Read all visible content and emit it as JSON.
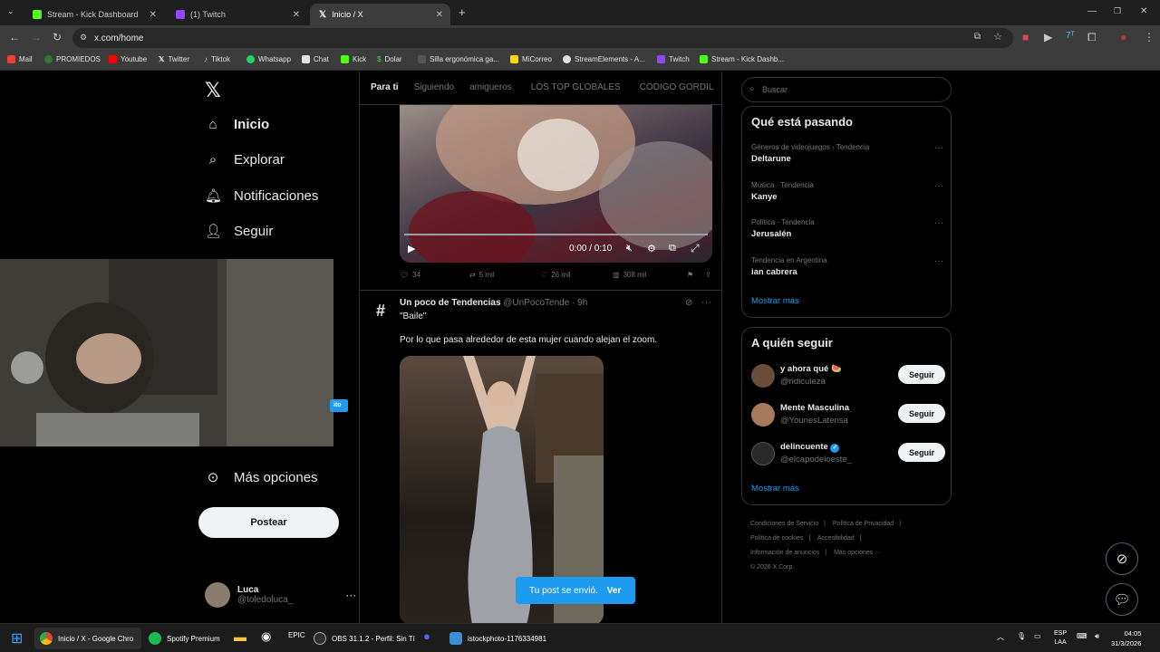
{
  "browser": {
    "tabs": [
      {
        "title": "Stream - Kick Dashboard",
        "color": "#53fc18"
      },
      {
        "title": "(1) Twitch",
        "color": "#9146ff"
      },
      {
        "title": "Inicio / X",
        "color": "#ffffff"
      }
    ],
    "new_tab": "+",
    "url": "x.com/home",
    "bookmarks": [
      "Mail",
      "PROMIEDOS",
      "Youtube",
      "Twitter",
      "Tiktok",
      "Whatsapp",
      "Chat",
      "Kick",
      "Dolar",
      "Silla ergonómica ga...",
      "MiCorreo",
      "StreamElements - A...",
      "Twitch",
      "Stream - Kick Dashb..."
    ]
  },
  "x": {
    "logo": "𝕏",
    "nav": {
      "home": "Inicio",
      "explore": "Explorar",
      "notifications": "Notificaciones",
      "follow": "Seguir",
      "more": "Más opciones"
    },
    "post_button": "Postear",
    "chip": "ito",
    "profile": {
      "name": "Luca",
      "handle": "@toledoluca_"
    },
    "feed_tabs": [
      "Para ti",
      "Siguiendo",
      "amigueros",
      "LOS TOP GLOBALES",
      "CODIGO GORDIL"
    ],
    "video": {
      "time": "0:00 / 0:10"
    },
    "stats": {
      "replies": "34",
      "reposts": "5 mil",
      "likes": "26 mil",
      "views": "308 mil"
    },
    "post": {
      "author": "Un poco de Tendencias",
      "handle": "@UnPocoTende · 9h",
      "line1": "\"Baile\"",
      "line2": "Por lo que pasa alrededor de esta mujer cuando alejan el zoom."
    },
    "toast": {
      "text": "Tu post se envió.",
      "action": "Ver"
    },
    "search_placeholder": "Buscar",
    "trends": {
      "title": "Qué está pasando",
      "items": [
        {
          "category": "Géneros de videojuegos · Tendencia",
          "name": "Deltarune"
        },
        {
          "category": "Música · Tendencia",
          "name": "Kanye"
        },
        {
          "category": "Política · Tendencia",
          "name": "Jerusalén"
        },
        {
          "category": "Tendencia en Argentina",
          "name": "ian cabrera"
        }
      ],
      "more": "Mostrar más"
    },
    "who_to_follow": {
      "title": "A quién seguir",
      "items": [
        {
          "name": "y ahora qué 🍉",
          "handle": "@ridiculeza",
          "button": "Seguir"
        },
        {
          "name": "Mente Masculina",
          "handle": "@YounesLatensa",
          "button": "Seguir"
        },
        {
          "name": "delincuente",
          "handle": "@elcapodeloeste_",
          "button": "Seguir"
        }
      ],
      "more": "Mostrar más"
    },
    "footer": {
      "links": [
        "Condiciones de Servicio",
        "Política de Privacidad",
        "Política de cookies",
        "Accesibilidad",
        "Información de anuncios",
        "Más opciones ···"
      ],
      "copyright": "© 2026 X Corp."
    }
  },
  "taskbar": {
    "items": [
      "Inicio / X - Google Chro",
      "Spotify Premium",
      "OBS 31.1.2 - Perfil: Sin Tí",
      "istockphoto-1176334981"
    ],
    "lang": "ESP",
    "lang2": "LAA",
    "time": "04:05",
    "date": "31/3/2026"
  },
  "colors": {
    "accent": "#1d9bf0",
    "background": "#000000",
    "border": "#2f3336",
    "muted": "#71767b"
  }
}
